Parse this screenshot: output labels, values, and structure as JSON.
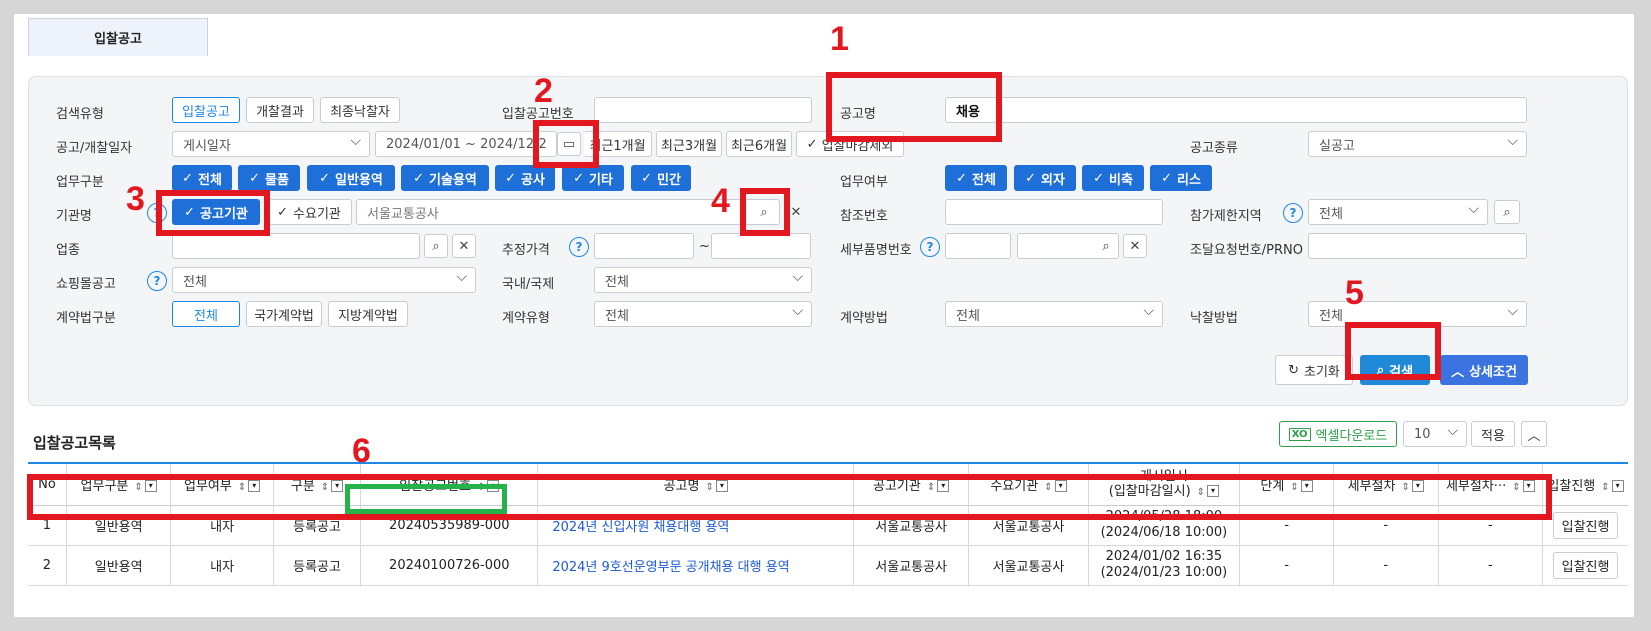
{
  "page_tab": "입찰공고",
  "search": {
    "search_type_label": "검색유형",
    "search_type_options": [
      "입찰공고",
      "개찰결과",
      "최종낙찰자"
    ],
    "bid_no_label": "입찰공고번호",
    "bid_no_value": "",
    "title_label": "공고명",
    "title_value": "채용",
    "date_label": "공고/개찰일자",
    "date_type": "게시일자",
    "date_range": "2024/01/01  ~  2024/12/",
    "date_range_tail": "2",
    "recent_1m": "최근1개월",
    "recent_3m": "최근3개월",
    "recent_6m": "최근6개월",
    "exclude_closed": "입찰마감제외",
    "notice_kind_label": "공고종류",
    "notice_kind_value": "실공고",
    "task_label": "업무구분",
    "task_chips": [
      "전체",
      "물품",
      "일반용역",
      "기술용역",
      "공사",
      "기타",
      "민간"
    ],
    "biz_label": "업무여부",
    "biz_chips": [
      "전체",
      "외자",
      "비축",
      "리스"
    ],
    "agency_label": "기관명",
    "agency_public": "공고기관",
    "agency_demand": "수요기관",
    "agency_value": "서울교통공사",
    "ref_no_label": "참조번호",
    "region_label": "참가제한지역",
    "region_value": "전체",
    "industry_label": "업종",
    "est_price_label": "추정가격",
    "price_sep": "~",
    "detail_item_label": "세부품명번호",
    "procure_label": "조달요청번호/PRNO",
    "mall_label": "쇼핑몰공고",
    "mall_value": "전체",
    "domestic_label": "국내/국제",
    "domestic_value": "전체",
    "contract_law_label": "계약법구분",
    "contract_law_options": [
      "전체",
      "국가계약법",
      "지방계약법"
    ],
    "contract_type_label": "계약유형",
    "contract_type_value": "전체",
    "contract_method_label": "계약방법",
    "contract_method_value": "전체",
    "award_method_label": "낙찰방법",
    "award_method_value": "전체",
    "reset_label": "초기화",
    "search_label": "검색",
    "detail_label": "상세조건"
  },
  "list": {
    "title": "입찰공고목록",
    "excel_label": "엑셀다운로드",
    "page_size": "10",
    "apply_label": "적용",
    "columns": [
      "No",
      "업무구분",
      "업무여부",
      "구분",
      "입찰공고번호",
      "공고명",
      "공고기관",
      "수요기관",
      "게시일시",
      "(입찰마감일시)",
      "단계",
      "세부절차",
      "세부절차···",
      "입찰진행"
    ],
    "rows": [
      {
        "no": "1",
        "task": "일반용역",
        "biz": "내자",
        "kind": "등록공고",
        "bid_no": "20240535989-000",
        "title": "2024년 신입사원 채용대행 용역",
        "agency": "서울교통공사",
        "demand": "서울교통공사",
        "posted": "2024/05/28 18:00",
        "deadline": "(2024/06/18 10:00)",
        "stage": "-",
        "proc1": "-",
        "proc2": "-",
        "action": "입찰진행"
      },
      {
        "no": "2",
        "task": "일반용역",
        "biz": "내자",
        "kind": "등록공고",
        "bid_no": "20240100726-000",
        "title": "2024년 9호선운영부문 공개채용 대행 용역",
        "agency": "서울교통공사",
        "demand": "서울교통공사",
        "posted": "2024/01/02 16:35",
        "deadline": "(2024/01/23 10:00)",
        "stage": "-",
        "proc1": "-",
        "proc2": "-",
        "action": "입찰진행"
      }
    ]
  },
  "annotations": [
    "1",
    "2",
    "3",
    "4",
    "5",
    "6"
  ],
  "colors": {
    "accent": "#1f6fd8",
    "annotation_red": "#e3171f",
    "annotation_green": "#25b24a"
  }
}
